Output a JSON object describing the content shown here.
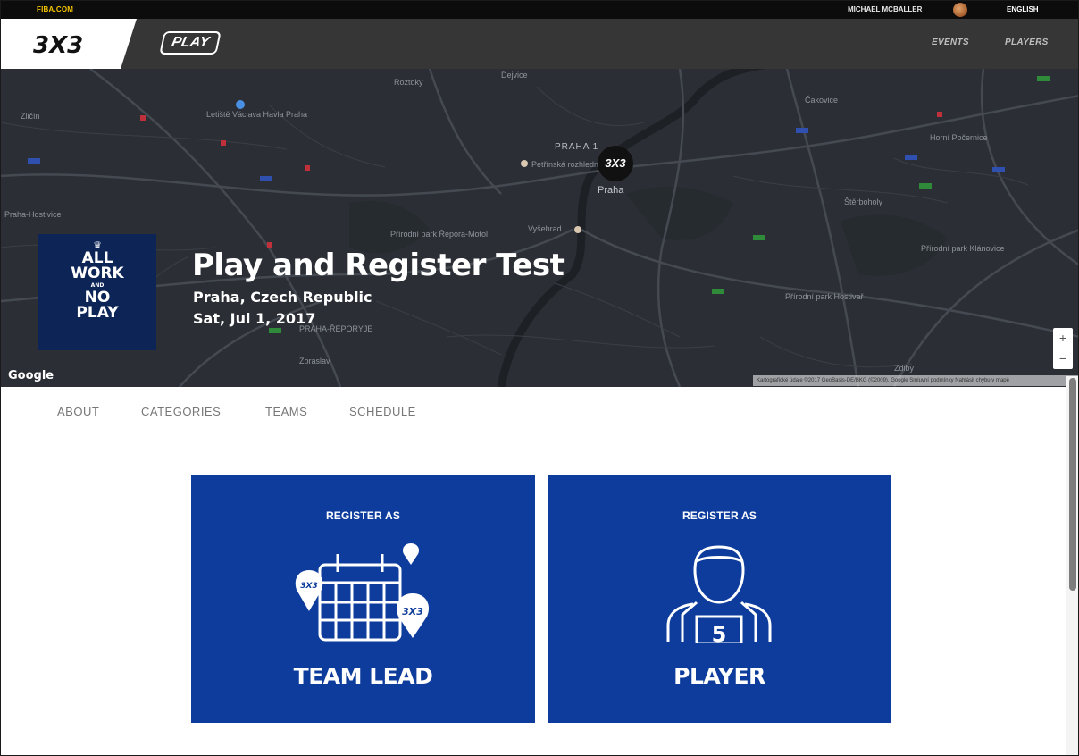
{
  "topbar": {
    "fiba_link": "FIBA.COM",
    "user_name": "MICHAEL MCBALLER",
    "language": "ENGLISH"
  },
  "navbar": {
    "logo_text": "3X3",
    "play_logo": "PLAY",
    "links": [
      "EVENTS",
      "PLAYERS"
    ]
  },
  "map": {
    "city_marker_text": "3X3",
    "district_label": "PRAHA 1",
    "city_label": "Praha",
    "labels": [
      "Letiště Václava Havla Praha",
      "Petřínská rozhledna",
      "Vyšehrad",
      "Přírodní park Řepora-Motol",
      "PRAHA-ŘEPORYJE",
      "Zbraslav",
      "Přírodní park Hostivař",
      "Přírodní park Klánovice",
      "Praha-Hostivice",
      "Zličín",
      "Roztoky",
      "Dejvice",
      "Čakovice",
      "Horní Počernice",
      "Štěrboholy",
      "Zdiby"
    ],
    "google_logo": "Google",
    "zoom_in": "+",
    "zoom_out": "−",
    "attribution": "Kartografické údaje ©2017 GeoBasis-DE/BKG (©2009), Google   Smluvní podmínky   Nahlásit chybu v mapě"
  },
  "event": {
    "poster_lines": [
      "ALL",
      "WORK",
      "AND",
      "NO",
      "PLAY"
    ],
    "title": "Play and Register Test",
    "location": "Praha, Czech Republic",
    "date": "Sat, Jul 1, 2017"
  },
  "tabs": [
    "ABOUT",
    "CATEGORIES",
    "TEAMS",
    "SCHEDULE"
  ],
  "cards": [
    {
      "heading": "REGISTER AS",
      "label": "TEAM LEAD",
      "icon": "team-calendar-icon"
    },
    {
      "heading": "REGISTER AS",
      "label": "PLAYER",
      "icon": "player-jersey-icon",
      "jersey_number": "5"
    }
  ],
  "colors": {
    "card_blue": "#0d3c9c",
    "poster_navy": "#0d2456",
    "fiba_yellow": "#f5c400",
    "map_dark": "#2b2f35"
  }
}
